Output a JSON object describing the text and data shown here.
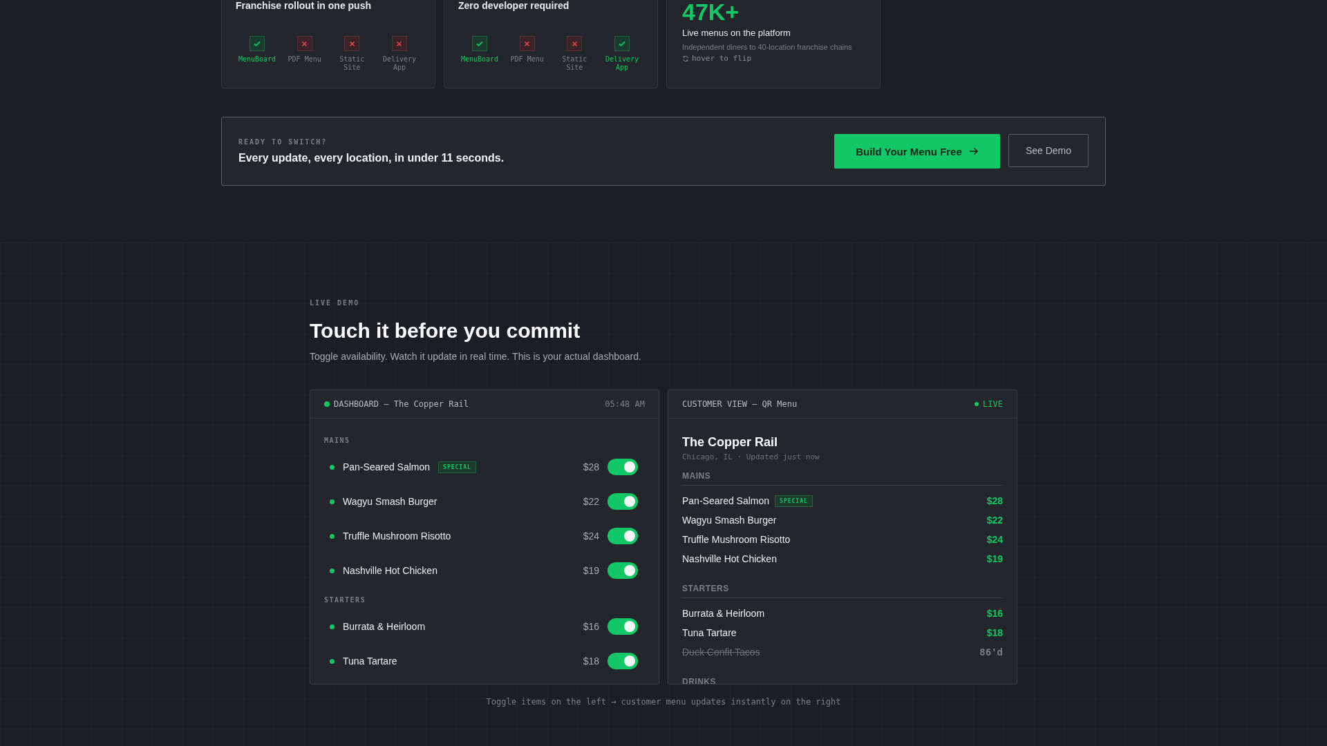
{
  "comparison_cards": [
    {
      "title": "Franchise rollout in one push",
      "options": [
        {
          "label": "MenuBoard",
          "supported": true
        },
        {
          "label": "PDF Menu",
          "supported": false
        },
        {
          "label": "Static Site",
          "supported": false
        },
        {
          "label": "Delivery App",
          "supported": false
        }
      ]
    },
    {
      "title": "Zero developer required",
      "options": [
        {
          "label": "MenuBoard",
          "supported": true
        },
        {
          "label": "PDF Menu",
          "supported": false
        },
        {
          "label": "Static Site",
          "supported": false
        },
        {
          "label": "Delivery App",
          "supported": true
        }
      ]
    }
  ],
  "stat_card": {
    "value": "47K+",
    "label": "Live menus on the platform",
    "description": "Independent diners to 40-location franchise chains",
    "hint": "hover to flip"
  },
  "cta": {
    "eyebrow": "READY TO SWITCH?",
    "headline": "Every update, every location, in under 11 seconds.",
    "primary_button": "Build Your Menu Free",
    "secondary_button": "See Demo"
  },
  "demo": {
    "eyebrow": "LIVE DEMO",
    "title": "Touch it before you commit",
    "subtitle": "Toggle availability. Watch it update in real time. This is your actual dashboard.",
    "footnote": "Toggle items on the left → customer menu updates instantly on the right"
  },
  "dashboard": {
    "title": "DASHBOARD — The Copper Rail",
    "time": "05:48 AM",
    "sections": [
      {
        "name": "MAINS",
        "items": [
          {
            "name": "Pan-Seared Salmon",
            "badge": "SPECIAL",
            "price": "$28",
            "available": true
          },
          {
            "name": "Wagyu Smash Burger",
            "price": "$22",
            "available": true
          },
          {
            "name": "Truffle Mushroom Risotto",
            "price": "$24",
            "available": true
          },
          {
            "name": "Nashville Hot Chicken",
            "price": "$19",
            "available": true
          }
        ]
      },
      {
        "name": "STARTERS",
        "items": [
          {
            "name": "Burrata & Heirloom",
            "price": "$16",
            "available": true
          },
          {
            "name": "Tuna Tartare",
            "price": "$18",
            "available": true
          }
        ]
      }
    ]
  },
  "customer_view": {
    "title": "CUSTOMER VIEW — QR Menu",
    "status": "LIVE",
    "restaurant": "The Copper Rail",
    "meta": "Chicago, IL · Updated just now",
    "sections": [
      {
        "name": "MAINS",
        "items": [
          {
            "name": "Pan-Seared Salmon",
            "badge": "SPECIAL",
            "price": "$28",
            "available": true
          },
          {
            "name": "Wagyu Smash Burger",
            "price": "$22",
            "available": true
          },
          {
            "name": "Truffle Mushroom Risotto",
            "price": "$24",
            "available": true
          },
          {
            "name": "Nashville Hot Chicken",
            "price": "$19",
            "available": true
          }
        ]
      },
      {
        "name": "STARTERS",
        "items": [
          {
            "name": "Burrata & Heirloom",
            "price": "$16",
            "available": true
          },
          {
            "name": "Tuna Tartare",
            "price": "$18",
            "available": true
          },
          {
            "name": "Duck Confit Tacos",
            "price": "86'd",
            "available": false
          }
        ]
      },
      {
        "name": "DRINKS"
      }
    ]
  }
}
